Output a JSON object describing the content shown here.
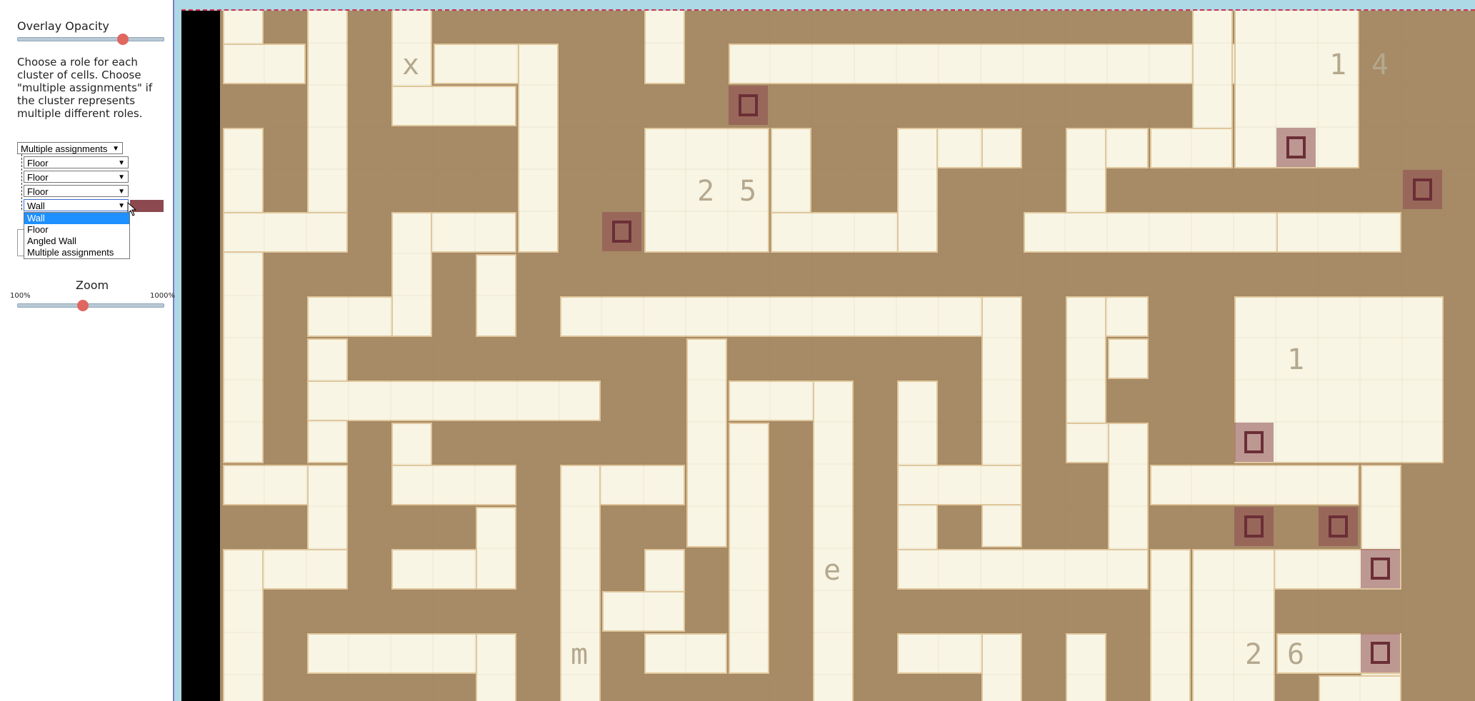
{
  "sidebar": {
    "overlay_opacity_label": "Overlay Opacity",
    "overlay_opacity_value": 0.72,
    "instructions": [
      "Choose a role for each",
      "cluster of cells. Choose",
      "\"multiple assignments\" if",
      "the cluster represents",
      "multiple different roles."
    ],
    "role_select": "Multiple assignments",
    "sub_selects": [
      "Floor",
      "Floor",
      "Floor",
      "Wall"
    ],
    "open_dropdown_options": [
      "Wall",
      "Floor",
      "Angled Wall",
      "Multiple assignments"
    ],
    "open_dropdown_selected": "Wall",
    "zoom_label": "Zoom",
    "zoom_min": "100%",
    "zoom_max": "1000%",
    "zoom_value": 0.44
  },
  "colors": {
    "floor": "#f8f5e4",
    "wall": "#a78a66",
    "overlay": "#8c4a50",
    "label": "#b4a88e"
  },
  "map_labels": [
    "x",
    "1",
    "4",
    "2",
    "5",
    "1",
    "e",
    "m",
    "2",
    "6"
  ]
}
